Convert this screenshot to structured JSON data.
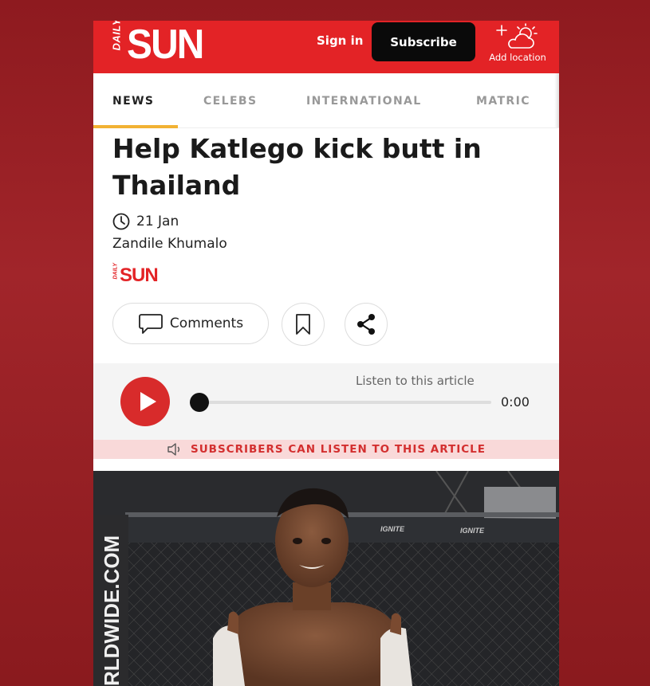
{
  "header": {
    "logo_small": "DAILY",
    "logo_main": "SUN",
    "signin": "Sign in",
    "subscribe": "Subscribe",
    "add_location": "Add location"
  },
  "nav": {
    "tabs": [
      {
        "label": "NEWS",
        "active": true
      },
      {
        "label": "CELEBS",
        "active": false
      },
      {
        "label": "INTERNATIONAL",
        "active": false
      },
      {
        "label": "MATRIC",
        "active": false
      }
    ]
  },
  "article": {
    "headline": "Help Katlego kick butt in Thailand",
    "date": "21 Jan",
    "author": "Zandile Khumalo",
    "source_logo_small": "DAILY",
    "source_logo_main": "SUN",
    "comments_label": "Comments"
  },
  "audio": {
    "listen_label": "Listen to this article",
    "time": "0:00",
    "progress": 0,
    "subscribers_notice": "SUBSCRIBERS CAN LISTEN TO THIS ARTICLE"
  },
  "photo": {
    "banner_text": "RLDWIDE.COM",
    "cage_brand": "IGNITE"
  },
  "colors": {
    "brand_red": "#e32326",
    "tab_underline": "#f2b233",
    "play_red": "#d82b2b"
  }
}
